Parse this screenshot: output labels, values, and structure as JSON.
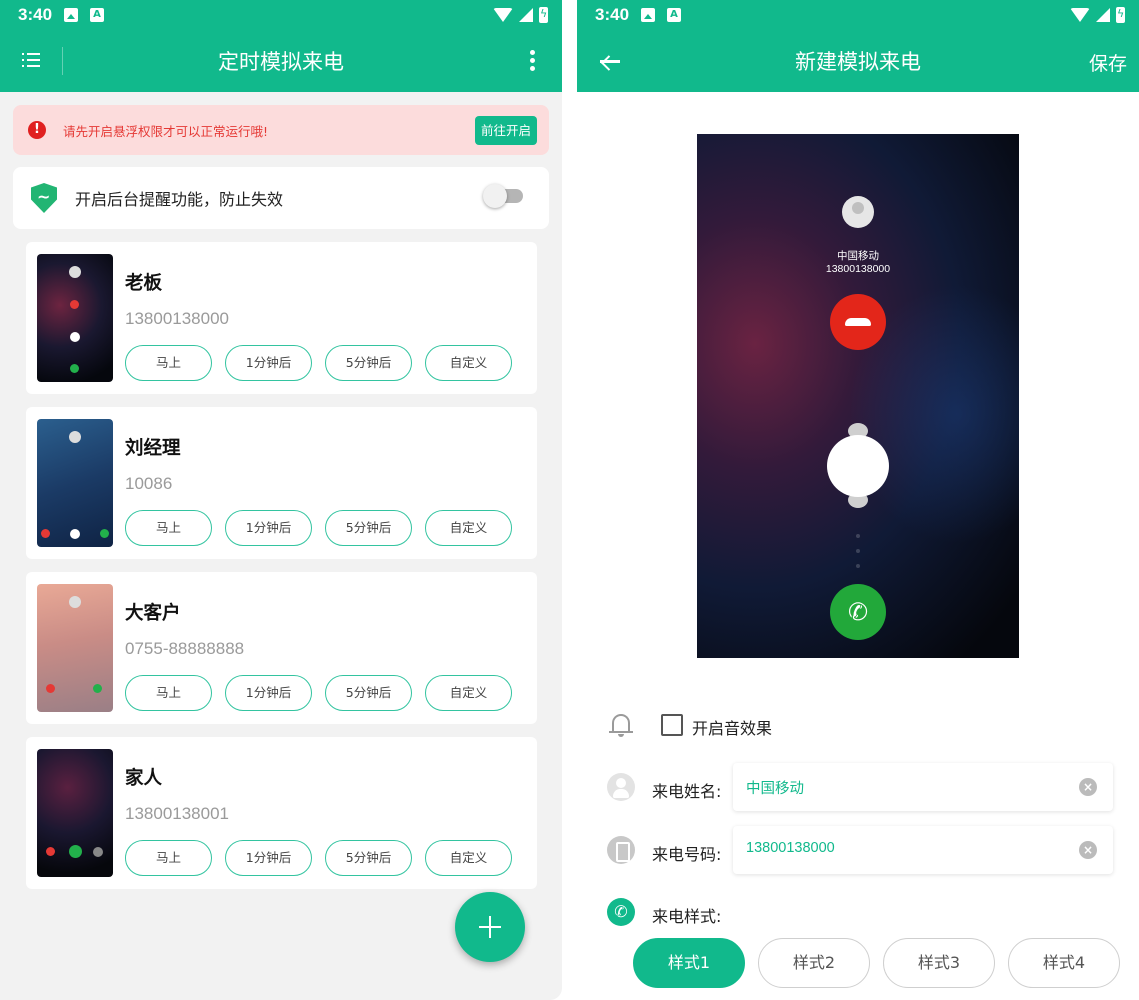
{
  "status": {
    "time": "3:40"
  },
  "left": {
    "title": "定时模拟来电",
    "alert": {
      "text": "请先开启悬浮权限才可以正常运行哦!",
      "button": "前往开启"
    },
    "background_reminder": {
      "label": "开启后台提醒功能，防止失效",
      "enabled": false
    },
    "buttons": [
      "马上",
      "1分钟后",
      "5分钟后",
      "自定义"
    ],
    "contacts": [
      {
        "name": "老板",
        "phone": "13800138000"
      },
      {
        "name": "刘经理",
        "phone": "10086"
      },
      {
        "name": "大客户",
        "phone": "0755-88888888"
      },
      {
        "name": "家人",
        "phone": "13800138001"
      }
    ]
  },
  "right": {
    "title": "新建模拟来电",
    "save": "保存",
    "preview": {
      "name": "中国移动",
      "number": "13800138000"
    },
    "sound_effect": {
      "label": "开启音效果",
      "checked": false
    },
    "caller_name": {
      "label": "来电姓名:",
      "value": "中国移动"
    },
    "caller_number": {
      "label": "来电号码:",
      "value": "13800138000"
    },
    "call_style": {
      "label": "来电样式:",
      "options": [
        "样式1",
        "样式2",
        "样式3",
        "样式4"
      ],
      "selected": "样式1"
    }
  },
  "colors": {
    "primary": "#11b98c",
    "alert_bg": "#fcdcdc",
    "alert_text": "#e53935",
    "decline": "#e3261a",
    "answer": "#22a83a"
  }
}
